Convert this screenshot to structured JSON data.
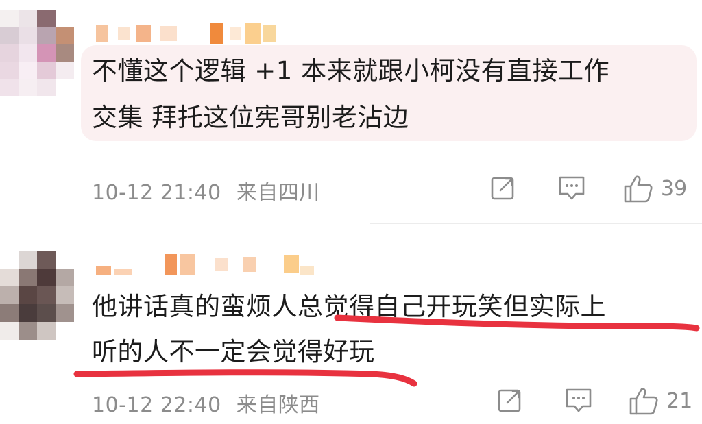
{
  "comments": [
    {
      "text_line1": "不懂这个逻辑 +1 本来就跟小柯没有直接工作",
      "text_line2": "交集 拜托这位宪哥别老沾边",
      "time": "10-12 21:40",
      "location": "来自四川",
      "likes": "39",
      "has_bubble": true,
      "icons": [
        "share-icon",
        "comment-icon",
        "like-icon"
      ]
    },
    {
      "text_line1_plain": "他讲话真的蛮烦人",
      "text_line1_highlight": "总觉得自己开玩笑但实际上",
      "text_line2": "听的人不一定会觉得好玩",
      "time": "10-12 22:40",
      "location": "来自陕西",
      "likes": "21",
      "has_bubble": false,
      "icons": [
        "share-icon",
        "comment-icon",
        "like-icon"
      ]
    }
  ],
  "annotation_color": "#e8323f",
  "bubble_color": "#fbf0f1",
  "meta_color": "#8c8c8c"
}
